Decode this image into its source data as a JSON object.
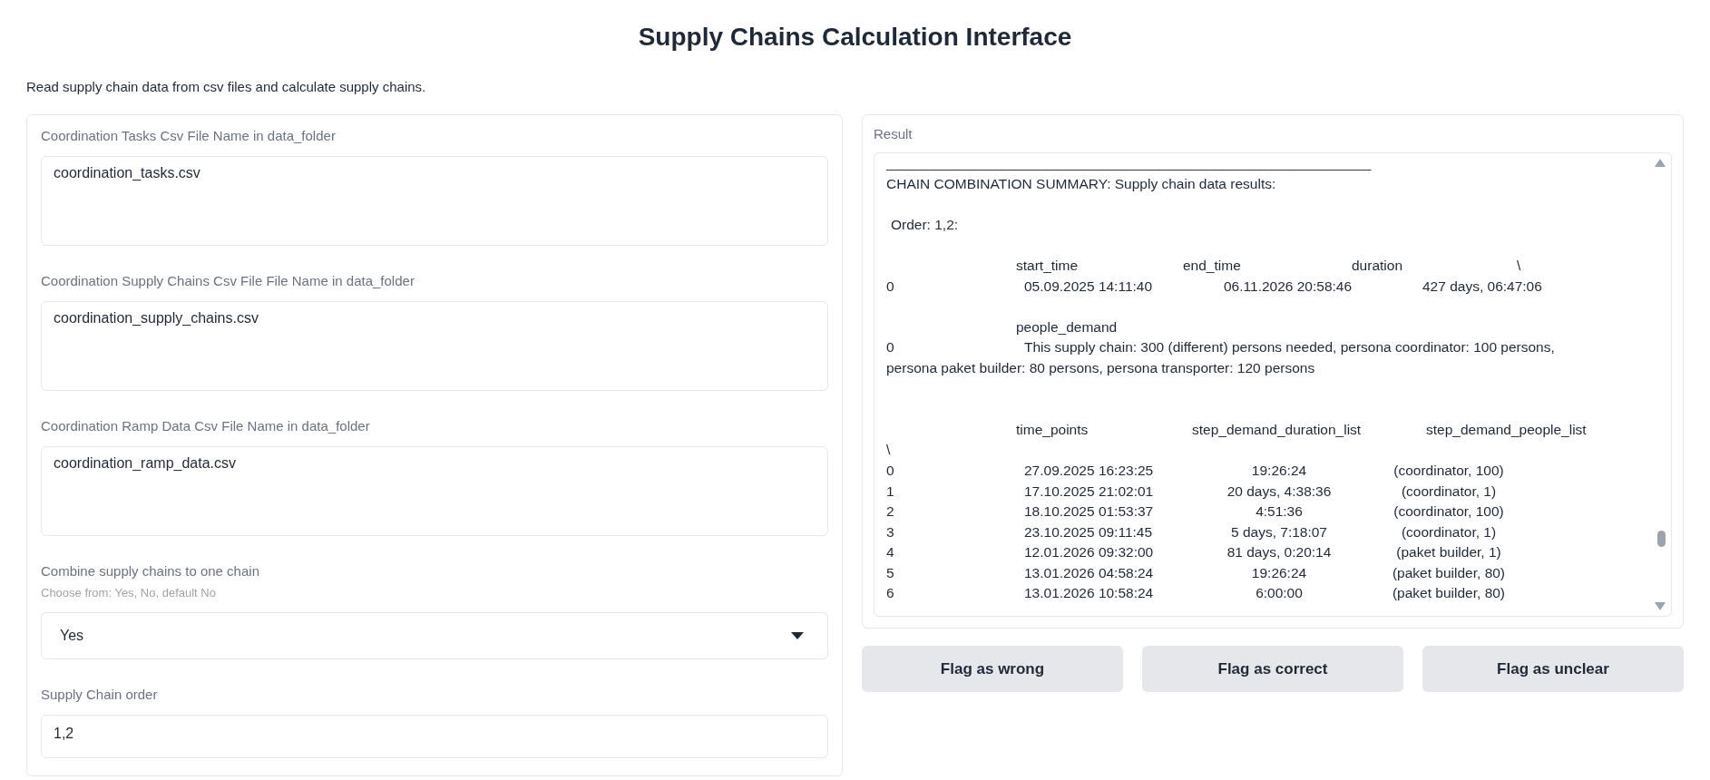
{
  "title": "Supply Chains Calculation Interface",
  "description": "Read supply chain data from csv files and calculate supply chains.",
  "inputs": [
    {
      "kind": "textarea",
      "label": "Coordination Tasks Csv File Name in data_folder",
      "value": "coordination_tasks.csv"
    },
    {
      "kind": "textarea",
      "label": "Coordination Supply Chains Csv File File Name in data_folder",
      "value": "coordination_supply_chains.csv"
    },
    {
      "kind": "textarea",
      "label": "Coordination Ramp Data Csv File Name in data_folder",
      "value": "coordination_ramp_data.csv"
    },
    {
      "kind": "dropdown",
      "label": "Combine supply chains to one chain",
      "info": "Choose from: Yes, No, default No",
      "value": "Yes"
    },
    {
      "kind": "textbox",
      "label": "Supply Chain order",
      "value": "1,2"
    }
  ],
  "result": {
    "label": "Result",
    "lines": [
      {
        "kind": "text",
        "text": "______________________________________________________________"
      },
      {
        "kind": "text",
        "text": "CHAIN COMBINATION SUMMARY: Supply chain data results:"
      },
      {
        "kind": "blank"
      },
      {
        "kind": "indented",
        "text": "Order: 1,2:"
      },
      {
        "kind": "blank"
      },
      {
        "kind": "header",
        "cells": [
          "start_time",
          "end_time",
          "duration",
          "\\"
        ]
      },
      {
        "kind": "row",
        "cells": [
          "0",
          "05.09.2025 14:11:40",
          "06.11.2026 20:58:46",
          "427 days, 06:47:06"
        ]
      },
      {
        "kind": "blank"
      },
      {
        "kind": "header",
        "cells": [
          "people_demand"
        ]
      },
      {
        "kind": "wrapped",
        "cells": [
          "0",
          "This supply chain: 300 (different) persons needed, persona coordinator: 100 persons, persona paket builder: 80 persons, persona transporter: 120 persons"
        ]
      },
      {
        "kind": "blank"
      },
      {
        "kind": "blank"
      },
      {
        "kind": "header",
        "cells": [
          "time_points",
          "step_demand_duration_list",
          "step_demand_people_list"
        ]
      },
      {
        "kind": "text",
        "text": "\\"
      },
      {
        "kind": "row",
        "cells": [
          "0",
          "27.09.2025 16:23:25",
          "19:26:24",
          "(coordinator, 100)"
        ]
      },
      {
        "kind": "row",
        "cells": [
          "1",
          "17.10.2025 21:02:01",
          "20 days, 4:38:36",
          "(coordinator, 1)"
        ]
      },
      {
        "kind": "row",
        "cells": [
          "2",
          "18.10.2025 01:53:37",
          "4:51:36",
          "(coordinator, 100)"
        ]
      },
      {
        "kind": "row",
        "cells": [
          "3",
          "23.10.2025 09:11:45",
          "5 days, 7:18:07",
          "(coordinator, 1)"
        ]
      },
      {
        "kind": "row",
        "cells": [
          "4",
          "12.01.2026 09:32:00",
          "81 days, 0:20:14",
          "(paket builder, 1)"
        ]
      },
      {
        "kind": "row",
        "cells": [
          "5",
          "13.01.2026 04:58:24",
          "19:26:24",
          "(paket builder, 80)"
        ]
      },
      {
        "kind": "row",
        "cells": [
          "6",
          "13.01.2026 10:58:24",
          "6:00:00",
          "(paket builder, 80)"
        ]
      }
    ]
  },
  "buttons": [
    "Flag as wrong",
    "Flag as correct",
    "Flag as unclear"
  ]
}
